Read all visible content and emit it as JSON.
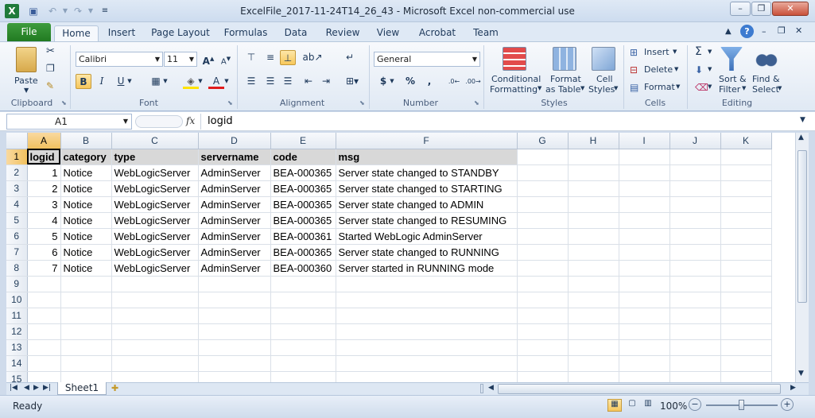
{
  "window": {
    "title": "ExcelFile_2017-11-24T14_26_43  -  Microsoft Excel non-commercial use",
    "minimize": "–",
    "restore": "❐",
    "close": "✕"
  },
  "ribbon_tabs": [
    "File",
    "Home",
    "Insert",
    "Page Layout",
    "Formulas",
    "Data",
    "Review",
    "View",
    "Acrobat",
    "Team"
  ],
  "clipboard": {
    "paste": "Paste",
    "group": "Clipboard"
  },
  "font": {
    "name": "Calibri",
    "size": "11",
    "bold": "B",
    "italic": "I",
    "underline": "U",
    "group": "Font"
  },
  "alignment": {
    "group": "Alignment"
  },
  "number": {
    "format": "General",
    "currency": "$",
    "percent": "%",
    "comma": ",",
    "group": "Number"
  },
  "styles": {
    "conditional": "Conditional",
    "formatting": "Formatting",
    "format_as": "Format",
    "as_table": "as Table",
    "cell": "Cell",
    "cell_styles": "Styles",
    "group": "Styles"
  },
  "cells": {
    "insert": "Insert",
    "delete": "Delete",
    "format": "Format",
    "group": "Cells"
  },
  "editing": {
    "sum": "Σ",
    "sort": "Sort &",
    "filter": "Filter",
    "find": "Find &",
    "select": "Select",
    "group": "Editing"
  },
  "formula_bar": {
    "name_box": "A1",
    "fx": "fx",
    "content": "logid"
  },
  "columns": [
    "A",
    "B",
    "C",
    "D",
    "E",
    "F",
    "G",
    "H",
    "I",
    "J",
    "K"
  ],
  "rows": [
    [
      "logid",
      "category",
      "type",
      "servername",
      "code",
      "msg"
    ],
    [
      "1",
      "Notice",
      "WebLogicServer",
      "AdminServer",
      "BEA-000365",
      "Server state changed to STANDBY"
    ],
    [
      "2",
      "Notice",
      "WebLogicServer",
      "AdminServer",
      "BEA-000365",
      "Server state changed to STARTING"
    ],
    [
      "3",
      "Notice",
      "WebLogicServer",
      "AdminServer",
      "BEA-000365",
      "Server state changed to ADMIN"
    ],
    [
      "4",
      "Notice",
      "WebLogicServer",
      "AdminServer",
      "BEA-000365",
      "Server state changed to RESUMING"
    ],
    [
      "5",
      "Notice",
      "WebLogicServer",
      "AdminServer",
      "BEA-000361",
      "Started WebLogic AdminServer"
    ],
    [
      "6",
      "Notice",
      "WebLogicServer",
      "AdminServer",
      "BEA-000365",
      "Server state changed to RUNNING"
    ],
    [
      "7",
      "Notice",
      "WebLogicServer",
      "AdminServer",
      "BEA-000360",
      "Server started in RUNNING mode"
    ]
  ],
  "row_numbers": [
    "1",
    "2",
    "3",
    "4",
    "5",
    "6",
    "7",
    "8",
    "9",
    "10",
    "11",
    "12",
    "13",
    "14",
    "15"
  ],
  "sheet_tab": "Sheet1",
  "status": {
    "ready": "Ready",
    "zoom": "100%"
  },
  "icons": {
    "app": "excel-logo-icon",
    "save": "save-icon",
    "undo": "undo-icon",
    "redo": "redo-icon",
    "help": "help-icon"
  }
}
